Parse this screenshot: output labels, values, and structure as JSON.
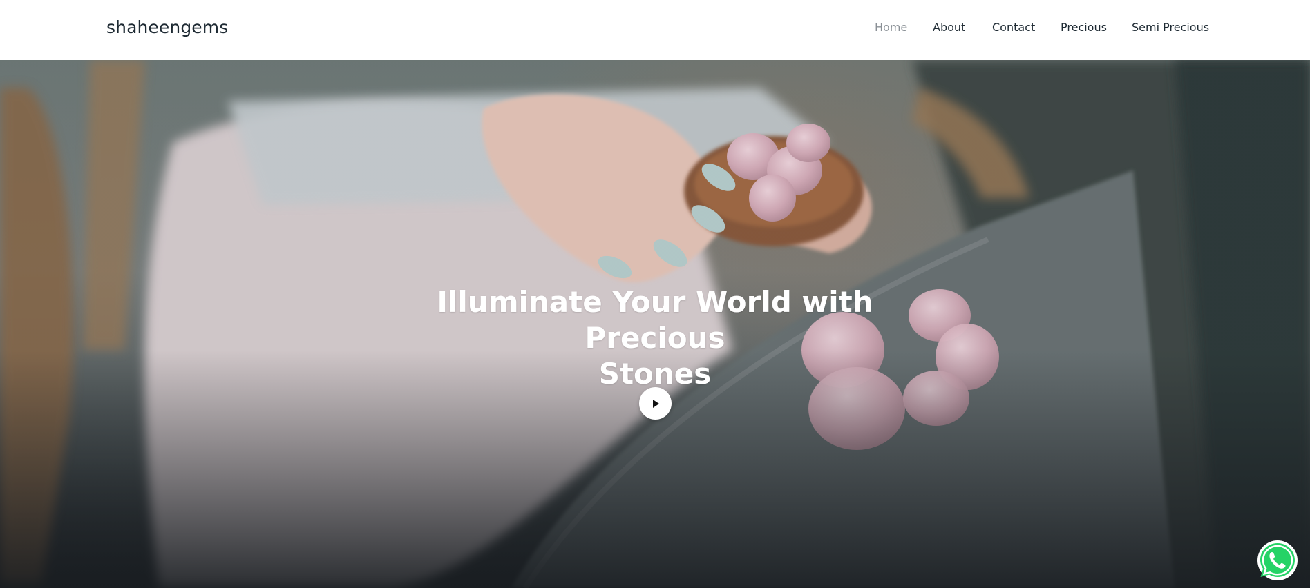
{
  "header": {
    "brand": "shaheengems",
    "nav": [
      {
        "label": "Home",
        "active": true
      },
      {
        "label": "About",
        "active": false
      },
      {
        "label": "Contact",
        "active": false
      },
      {
        "label": "Precious",
        "active": false
      },
      {
        "label": "Semi Precious",
        "active": false
      }
    ]
  },
  "hero": {
    "title_line1": "Illuminate Your World with Precious",
    "title_line2": "Stones",
    "play_icon": "play-icon",
    "background_subject": "hands holding rose quartz stones"
  },
  "floating": {
    "whatsapp_icon": "whatsapp-icon"
  },
  "colors": {
    "header_bg": "#ffffff",
    "nav_text": "#1e2a33",
    "nav_active": "#8a9096",
    "whatsapp_green": "#25d366",
    "hero_text": "#ffffff"
  }
}
